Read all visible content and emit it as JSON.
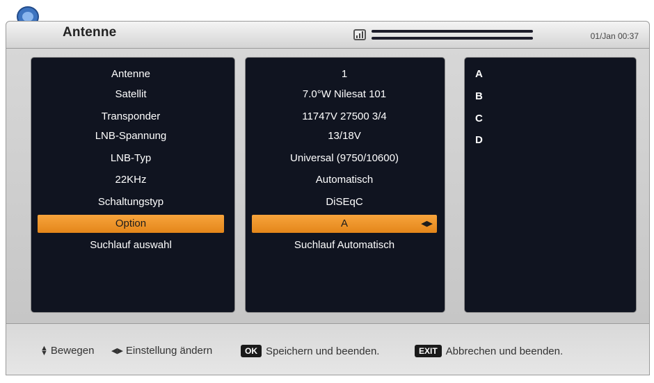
{
  "header": {
    "title": "Antenne",
    "clock": "01/Jan 00:37"
  },
  "settings": [
    {
      "label": "Antenne",
      "value": "1"
    },
    {
      "label": "Satellit",
      "value": "7.0°W Nilesat 101"
    },
    {
      "label": "Transponder",
      "value": "11747V 27500 3/4"
    },
    {
      "label": "LNB-Spannung",
      "value": "13/18V"
    },
    {
      "label": "LNB-Typ",
      "value": "Universal (9750/10600)"
    },
    {
      "label": "22KHz",
      "value": "Automatisch"
    },
    {
      "label": "Schaltungstyp",
      "value": "DiSEqC"
    },
    {
      "label": "Option",
      "value": "A",
      "selected": true
    },
    {
      "label": "Suchlauf auswahl",
      "value": "Suchlauf Automatisch"
    }
  ],
  "options": [
    "A",
    "B",
    "C",
    "D"
  ],
  "footer": {
    "move_label": "Bewegen",
    "change_label": "Einstellung ändern",
    "ok_key": "OK",
    "ok_label": "Speichern und beenden.",
    "exit_key": "EXIT",
    "exit_label": "Abbrechen und beenden."
  },
  "colors": {
    "highlight": "#f09a2e",
    "panel": "#101420"
  },
  "icons": {
    "logo": "satellite-dish-icon",
    "signal": "signal-icon",
    "updown": "up-down-arrow-icon",
    "leftright": "left-right-arrow-icon"
  }
}
